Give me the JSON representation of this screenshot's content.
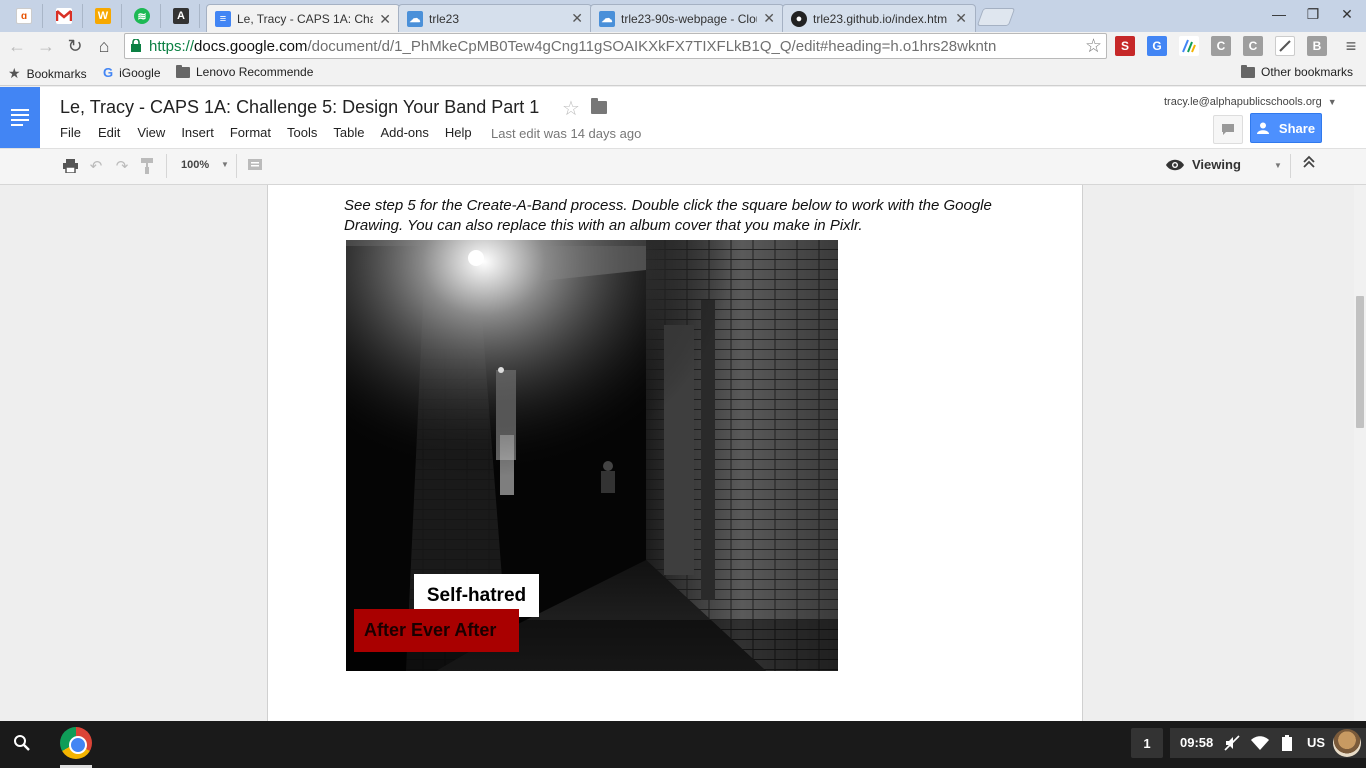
{
  "browser": {
    "pinned_tabs": [
      {
        "icon": "ai-favicon-icon",
        "color": "#ffffff"
      },
      {
        "icon": "gmail-favicon-icon",
        "color": "#d93025"
      },
      {
        "icon": "w-favicon-icon",
        "color": "#f7a800",
        "glyph": "W"
      },
      {
        "icon": "spotify-favicon-icon",
        "color": "#1db954"
      },
      {
        "icon": "a-favicon-icon",
        "color": "#333333",
        "glyph": "A"
      }
    ],
    "tabs": [
      {
        "title": "Le, Tracy - CAPS 1A: Chall",
        "icon": "docs-favicon-icon",
        "active": true
      },
      {
        "title": "trle23",
        "icon": "cloud9-favicon-icon",
        "active": false
      },
      {
        "title": "trle23-90s-webpage - Clou",
        "icon": "cloud9-favicon-icon",
        "active": false
      },
      {
        "title": "trle23.github.io/index.htm",
        "icon": "github-favicon-icon",
        "active": false
      }
    ],
    "url": {
      "scheme": "https://",
      "host": "docs.google.com",
      "path": "/document/d/1_PhMkeCpMB0Tew4gCng11gSOAIKXkFX7TIXFLkB1Q_Q/edit#heading=h.o1hrs28wkntn"
    },
    "extensions": [
      {
        "icon": "s-extension-icon",
        "glyph": "S",
        "color": "#c62828"
      },
      {
        "icon": "translate-extension-icon",
        "glyph": "G",
        "color": "#4285f4"
      },
      {
        "icon": "pen-extension-icon",
        "glyph": "/",
        "color": "#ffffff"
      },
      {
        "icon": "c-extension-icon",
        "glyph": "C",
        "color": "#9e9e9e"
      },
      {
        "icon": "c-extension-icon",
        "glyph": "C",
        "color": "#9e9e9e"
      },
      {
        "icon": "note-extension-icon",
        "glyph": "/",
        "color": "#ffffff"
      },
      {
        "icon": "b-extension-icon",
        "glyph": "B",
        "color": "#9e9e9e"
      }
    ],
    "bookmarks": [
      {
        "label": "Bookmarks",
        "icon": "star-icon"
      },
      {
        "label": "iGoogle",
        "icon": "google-icon"
      },
      {
        "label": "Lenovo Recommende",
        "icon": "folder-icon"
      }
    ],
    "other_bookmarks": "Other bookmarks"
  },
  "docs": {
    "title": "Le, Tracy - CAPS 1A: Challenge 5: Design Your Band Part 1",
    "menu": [
      "File",
      "Edit",
      "View",
      "Insert",
      "Format",
      "Tools",
      "Table",
      "Add-ons",
      "Help"
    ],
    "last_edit": "Last edit was 14 days ago",
    "account": "tracy.le@alphapublicschools.org",
    "share_label": "Share",
    "zoom": "100%",
    "mode": "Viewing",
    "accent": "#4285f4"
  },
  "document": {
    "instructions": "See step 5 for the Create-A-Band process. Double click the square below to work with the Google Drawing. You can also replace this with an album cover that you make in Pixlr.",
    "album": {
      "label_white": "Self-hatred",
      "label_red": "After Ever After",
      "red_color": "#a90000"
    }
  },
  "shelf": {
    "notification_count": "1",
    "time": "09:58",
    "keyboard": "US"
  }
}
